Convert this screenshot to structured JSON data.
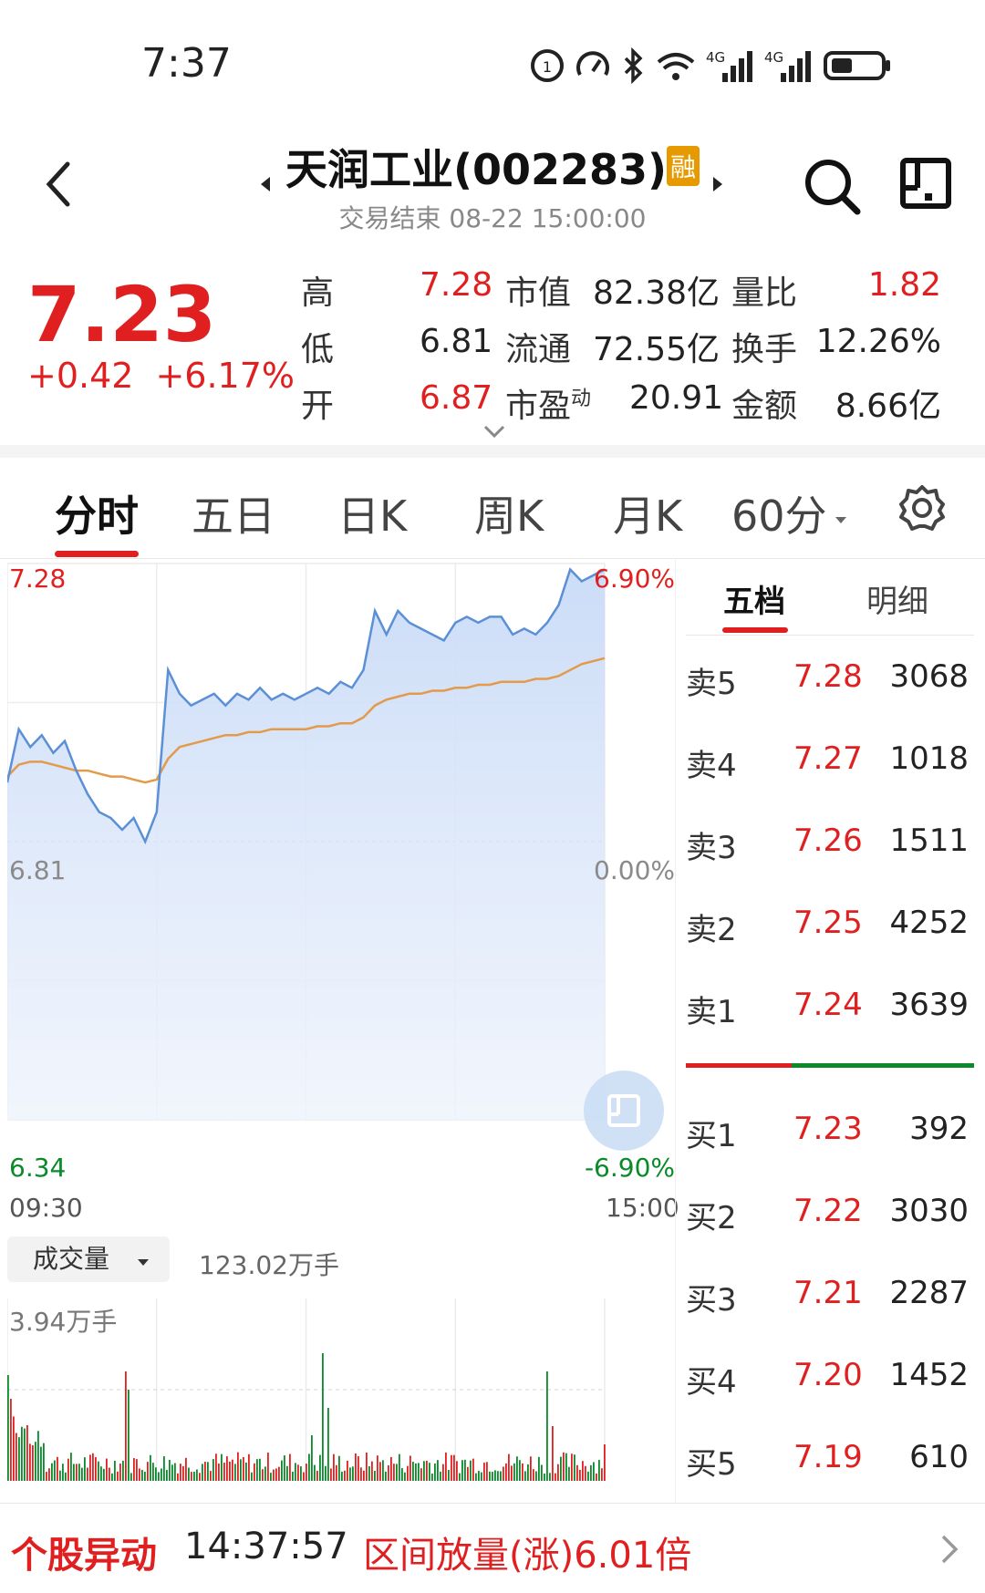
{
  "status_bar": {
    "time": "7:37"
  },
  "header": {
    "stock_title": "天润工业(002283)",
    "badge": "融",
    "trade_status": "交易结束 08-22 15:00:00"
  },
  "quote": {
    "price": "7.23",
    "change": "+0.42",
    "change_pct": "+6.17%",
    "high_label": "高",
    "high": "7.28",
    "low_label": "低",
    "low": "6.81",
    "open_label": "开",
    "open": "6.87",
    "mktcap_label": "市值",
    "mktcap": "82.38亿",
    "float_label": "流通",
    "float": "72.55亿",
    "pe_label": "市盈",
    "pe_sup": "动",
    "pe": "20.91",
    "volratio_label": "量比",
    "volratio": "1.82",
    "turnover_label": "换手",
    "turnover": "12.26%",
    "amount_label": "金额",
    "amount": "8.66亿"
  },
  "tabs": [
    "分时",
    "五日",
    "日K",
    "周K",
    "月K",
    "60分"
  ],
  "chart_labels": {
    "top_price": "7.28",
    "top_pct": "6.90%",
    "mid_price": "6.81",
    "mid_pct": "0.00%",
    "bot_price": "6.34",
    "bot_pct": "-6.90%",
    "time_start": "09:30",
    "time_end": "15:00"
  },
  "volume": {
    "selector": "成交量",
    "total": "123.02万手",
    "axis_max": "3.94万手"
  },
  "orderbook": {
    "tab_five": "五档",
    "tab_detail": "明细",
    "sell": [
      {
        "label": "卖5",
        "price": "7.28",
        "vol": "3068"
      },
      {
        "label": "卖4",
        "price": "7.27",
        "vol": "1018"
      },
      {
        "label": "卖3",
        "price": "7.26",
        "vol": "1511"
      },
      {
        "label": "卖2",
        "price": "7.25",
        "vol": "4252"
      },
      {
        "label": "卖1",
        "price": "7.24",
        "vol": "3639"
      }
    ],
    "buy": [
      {
        "label": "买1",
        "price": "7.23",
        "vol": "392"
      },
      {
        "label": "买2",
        "price": "7.22",
        "vol": "3030"
      },
      {
        "label": "买3",
        "price": "7.21",
        "vol": "2287"
      },
      {
        "label": "买4",
        "price": "7.20",
        "vol": "1452"
      },
      {
        "label": "买5",
        "price": "7.19",
        "vol": "610"
      }
    ]
  },
  "alert": {
    "label": "个股异动",
    "time": "14:37:57",
    "message": "区间放量(涨)6.01倍"
  },
  "colors": {
    "up": "#e02020",
    "down": "#0a8a2a",
    "price_line": "#5b8fd6",
    "avg_line": "#e39a4a",
    "badge": "#e69a00"
  },
  "chart_data": {
    "type": "line",
    "ylim": [
      6.34,
      7.28
    ],
    "x": [
      "09:30",
      "15:00"
    ],
    "series": [
      {
        "values": [
          6.91,
          7.0,
          6.97,
          6.99,
          6.96,
          6.98,
          6.93,
          6.89,
          6.86,
          6.85,
          6.83,
          6.85,
          6.81,
          6.86,
          7.1,
          7.06,
          7.04,
          7.05,
          7.06,
          7.04,
          7.06,
          7.05,
          7.07,
          7.05,
          7.06,
          7.05,
          7.06,
          7.07,
          7.06,
          7.08,
          7.07,
          7.1,
          7.2,
          7.16,
          7.2,
          7.18,
          7.17,
          7.16,
          7.15,
          7.18,
          7.19,
          7.18,
          7.19,
          7.19,
          7.16,
          7.17,
          7.16,
          7.18,
          7.21,
          7.27,
          7.25,
          7.26,
          7.27
        ]
      },
      {
        "values": [
          6.92,
          6.94,
          6.945,
          6.945,
          6.94,
          6.935,
          6.93,
          6.93,
          6.925,
          6.92,
          6.92,
          6.915,
          6.91,
          6.915,
          6.95,
          6.97,
          6.975,
          6.98,
          6.985,
          6.99,
          6.99,
          6.995,
          6.995,
          7.0,
          7.0,
          7.0,
          7.0,
          7.005,
          7.005,
          7.01,
          7.01,
          7.02,
          7.04,
          7.05,
          7.055,
          7.06,
          7.06,
          7.065,
          7.065,
          7.07,
          7.07,
          7.075,
          7.075,
          7.08,
          7.08,
          7.08,
          7.085,
          7.085,
          7.09,
          7.1,
          7.11,
          7.115,
          7.12
        ]
      }
    ]
  }
}
